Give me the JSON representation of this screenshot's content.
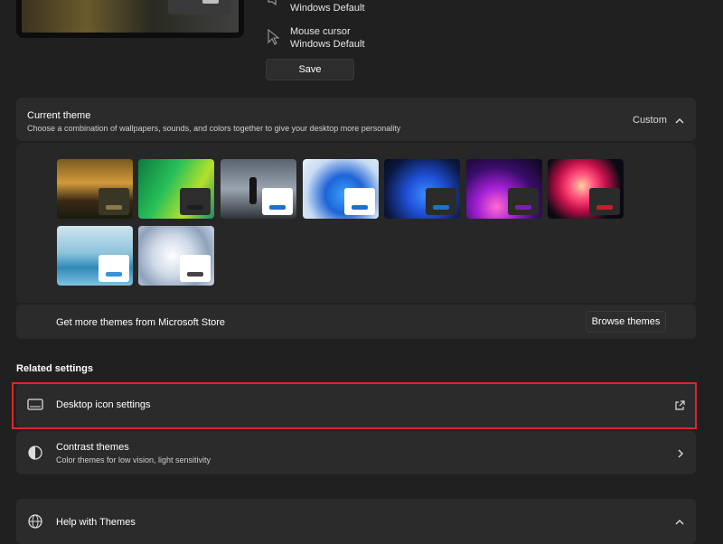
{
  "top": {
    "sound_value": "Windows Default",
    "mouse_cursor_label": "Mouse cursor",
    "mouse_cursor_value": "Windows Default",
    "save_label": "Save"
  },
  "current_theme": {
    "title": "Current theme",
    "description": "Choose a combination of wallpapers, sounds, and colors together to give your desktop more personality",
    "value": "Custom",
    "themes": [
      {
        "name": "forest",
        "accent": "#8a7a4a",
        "win": "#3a3626"
      },
      {
        "name": "green-flow",
        "accent": "#1e1e1e",
        "win": "#2d2d2d"
      },
      {
        "name": "silhouette",
        "accent": "#1f6fd0",
        "win": "#ffffff"
      },
      {
        "name": "windows-light",
        "accent": "#1f6fd0",
        "win": "#ffffff"
      },
      {
        "name": "windows-dark",
        "accent": "#1f6fd0",
        "win": "#2b2b2b"
      },
      {
        "name": "glow",
        "accent": "#7a1fb5",
        "win": "#2b2b2b"
      },
      {
        "name": "flower",
        "accent": "#c41f28",
        "win": "#2b2b2b"
      },
      {
        "name": "lake",
        "accent": "#3a94d8",
        "win": "#ffffff"
      },
      {
        "name": "bloom-light",
        "accent": "#444444",
        "win": "#ffffff"
      }
    ],
    "store_text": "Get more themes from Microsoft Store",
    "browse_label": "Browse themes"
  },
  "related_settings": {
    "heading": "Related settings",
    "desktop_icon_label": "Desktop icon settings",
    "contrast_title": "Contrast themes",
    "contrast_sub": "Color themes for low vision, light sensitivity"
  },
  "help": {
    "title": "Help with Themes"
  },
  "colors": {
    "highlight": "#e0262c"
  }
}
